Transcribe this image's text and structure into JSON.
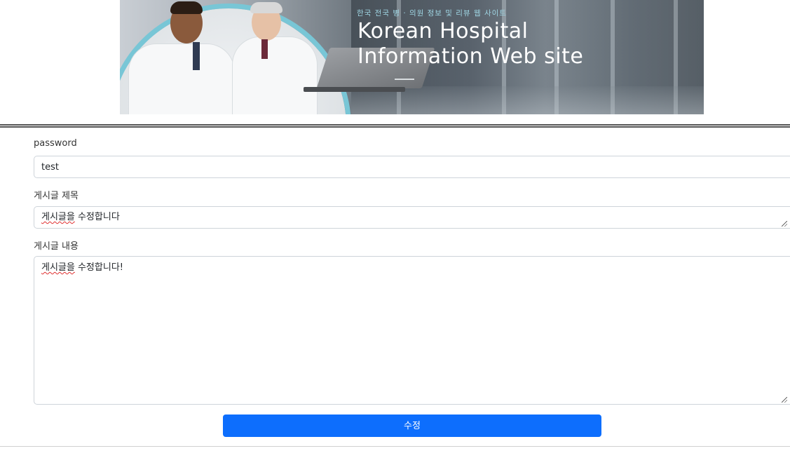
{
  "banner": {
    "tagline": "한국 전국 병 · 의원 정보 및 리뷰 웹 사이트",
    "title_line1": "Korean Hospital",
    "title_line2": "Information Web site",
    "ring_color": "#78c6d6"
  },
  "form": {
    "password": {
      "label": "password",
      "value": "test"
    },
    "title": {
      "label": "게시글 제목",
      "value": "게시글을 수정합니다",
      "squiggle": "게시글을",
      "rest": " 수정합니다"
    },
    "content": {
      "label": "게시글 내용",
      "value": "게시글을 수정합니다!",
      "squiggle": "게시글을",
      "rest": " 수정합니다!"
    },
    "submit_label": "수정",
    "submit_color": "#0d6efd"
  }
}
